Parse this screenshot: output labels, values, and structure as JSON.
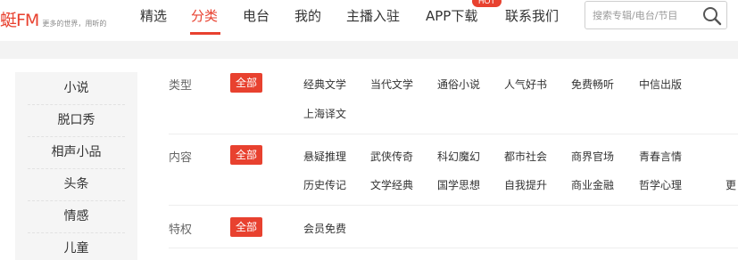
{
  "header": {
    "logo_text": "蜓FM",
    "slogan": "更多的世界，用听的",
    "nav": [
      {
        "label": "精选",
        "active": false
      },
      {
        "label": "分类",
        "active": true
      },
      {
        "label": "电台",
        "active": false
      },
      {
        "label": "我的",
        "active": false
      },
      {
        "label": "主播入驻",
        "active": false
      },
      {
        "label": "APP下载",
        "active": false
      },
      {
        "label": "联系我们",
        "active": false
      }
    ],
    "hot_badge": "HOT",
    "search_placeholder": "搜索专辑/电台/节目",
    "accent_color": "#e8412f"
  },
  "sidebar": {
    "items": [
      "小说",
      "脱口秀",
      "相声小品",
      "头条",
      "情感",
      "儿童"
    ]
  },
  "filters": [
    {
      "label": "类型",
      "all_label": "全部",
      "tags": [
        "经典文学",
        "当代文学",
        "通俗小说",
        "人气好书",
        "免费畅听",
        "中信出版",
        "上海译文"
      ]
    },
    {
      "label": "内容",
      "all_label": "全部",
      "tags": [
        "悬疑推理",
        "武侠传奇",
        "科幻魔幻",
        "都市社会",
        "商界官场",
        "青春言情",
        "历史传记",
        "文学经典",
        "国学思想",
        "自我提升",
        "商业金融",
        "哲学心理",
        "更"
      ]
    },
    {
      "label": "特权",
      "all_label": "全部",
      "tags": [
        "会员免费"
      ]
    }
  ]
}
